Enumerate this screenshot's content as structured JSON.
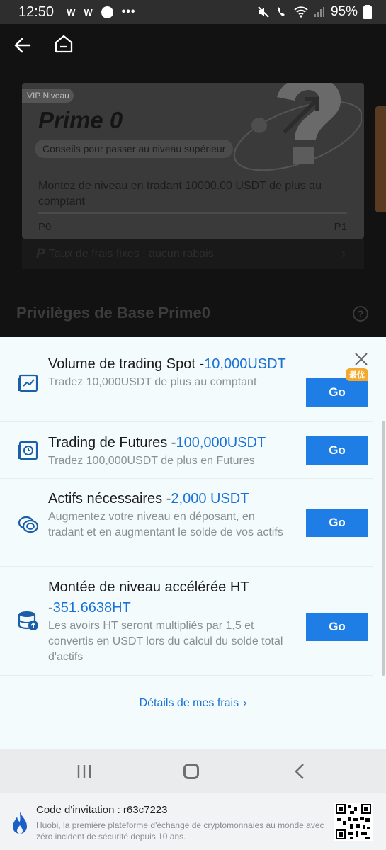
{
  "status_bar": {
    "time": "12:50",
    "app_icons": [
      "W",
      "W"
    ],
    "more": "•••",
    "battery": "95%"
  },
  "vip_card": {
    "badge": "VIP Niveau",
    "level": "Prime 0",
    "tip": "Conseils pour passer au niveau supérieur",
    "description": "Montez de niveau en tradant 10000.00 USDT de plus au comptant",
    "progress_start": "P0",
    "progress_end": "P1",
    "progress_fraction": 0
  },
  "fee_bar": {
    "label": "Taux de frais fixes ; aucun rabais"
  },
  "privileges": {
    "title": "Privilèges de Base Prime0"
  },
  "tasks": [
    {
      "title": "Volume de trading Spot -",
      "amount": "10,000USDT",
      "description": "Tradez 10,000USDT de plus au comptant",
      "button": "Go",
      "tag": "最优"
    },
    {
      "title": "Trading de Futures -",
      "amount": "100,000USDT",
      "description": "Tradez 100,000USDT de plus en Futures",
      "button": "Go"
    },
    {
      "title": "Actifs nécessaires -",
      "amount": "2,000 USDT",
      "description": "Augmentez votre niveau en déposant, en tradant et en augmentant le solde de vos actifs",
      "button": "Go"
    },
    {
      "title": "Montée de niveau accélérée HT -",
      "amount": "351.6638HT",
      "description": "Les avoirs HT seront multipliés par 1,5 et convertis en USDT lors du calcul du solde total d'actifs",
      "button": "Go"
    }
  ],
  "details_link": "Détails de mes frais",
  "invite": {
    "code": "Code d'invitation : r63c7223",
    "description": "Huobi, la première plateforme d'échange de cryptomonnaies au monde avec zéro incident de sécurité depuis 10 ans."
  },
  "colors": {
    "accent": "#1e7ee6",
    "amount": "#1a72d6",
    "tag": "#f4a92c",
    "sheet_bg": "#f4fbfd"
  }
}
